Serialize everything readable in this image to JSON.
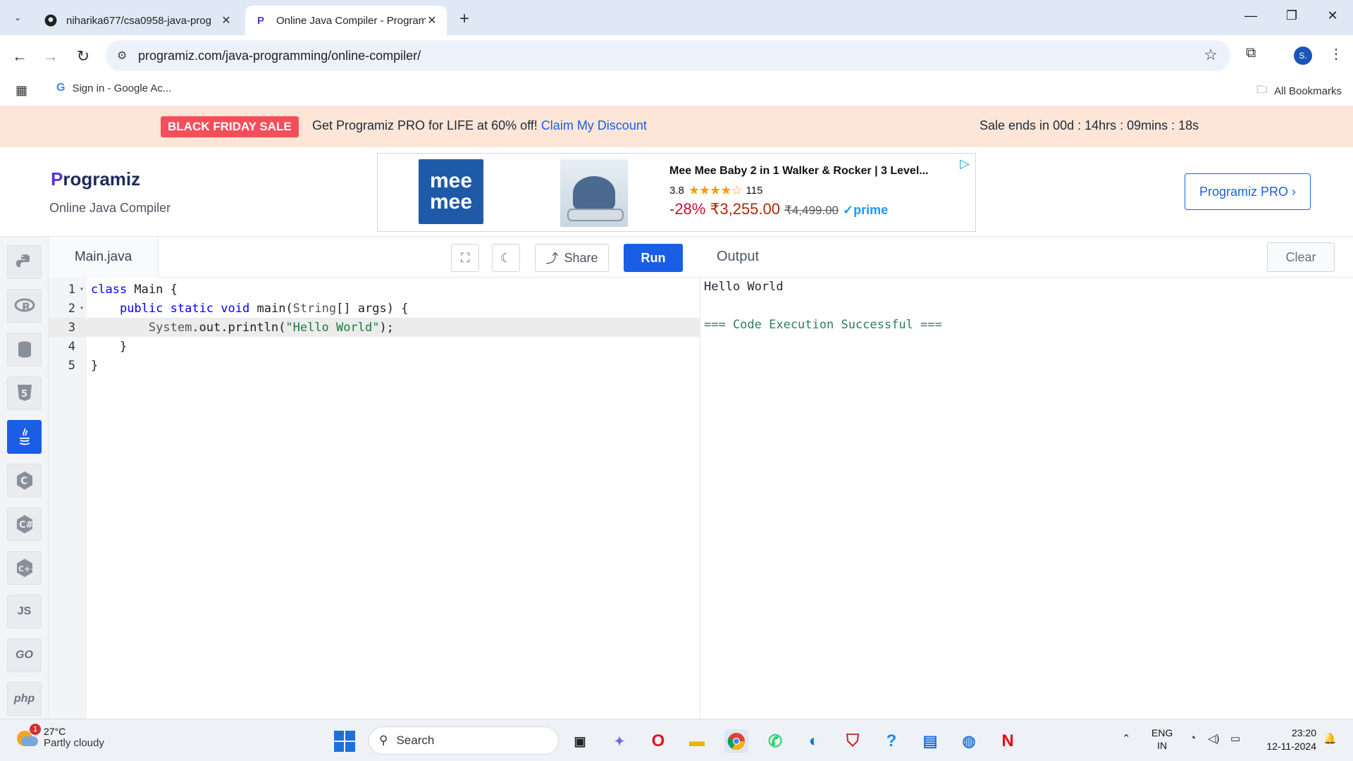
{
  "browser": {
    "tabs": [
      {
        "title": "niharika677/csa0958-java-prog",
        "active": false
      },
      {
        "title": "Online Java Compiler - Program",
        "active": true
      }
    ],
    "url": "programiz.com/java-programming/online-compiler/",
    "profile_initial": "S.",
    "bookmarks": [
      {
        "label": "Sign in - Google Ac..."
      }
    ],
    "all_bookmarks_label": "All Bookmarks"
  },
  "sale": {
    "badge": "BLACK FRIDAY SALE",
    "text": "Get Programiz PRO for LIFE at 60% off!",
    "link": "Claim My Discount",
    "timer": "Sale ends in 00d : 14hrs : 09mins : 18s"
  },
  "header": {
    "logo": "rogramiz",
    "logo_p": "P",
    "subtitle": "Online Java Compiler",
    "pro_button": "Programiz PRO ›"
  },
  "ad": {
    "brand_line1": "mee",
    "brand_line2": "mee",
    "title": "Mee Mee Baby 2 in 1 Walker & Rocker | 3 Level...",
    "rating": "3.8",
    "stars": "★★★★☆",
    "reviews": "115",
    "discount": "-28%",
    "price": "₹3,255.00",
    "old_price": "₹4,499.00",
    "prime": "✓prime"
  },
  "languages": [
    "python",
    "r",
    "sql",
    "html",
    "java",
    "c",
    "csharp",
    "cpp",
    "JS",
    "GO",
    "php"
  ],
  "editor": {
    "file_name": "Main.java",
    "share_label": "Share",
    "run_label": "Run",
    "lines": [
      {
        "n": "1",
        "fold": "▾"
      },
      {
        "n": "2",
        "fold": "▾"
      },
      {
        "n": "3",
        "fold": ""
      },
      {
        "n": "4",
        "fold": ""
      },
      {
        "n": "5",
        "fold": ""
      }
    ],
    "code": {
      "l1_kw": "class",
      "l1_rest": " Main {",
      "l2_kw1": "public",
      "l2_kw2": "static",
      "l2_kw3": "void",
      "l2_a": " main(",
      "l2_type": "String",
      "l2_b": "[] args) {",
      "l3_cls": "System",
      "l3_a": ".out.println(",
      "l3_str": "\"Hello World\"",
      "l3_b": ");",
      "l4": "    }",
      "l5": "}"
    }
  },
  "output": {
    "title": "Output",
    "clear_label": "Clear",
    "lines": [
      "Hello World",
      "=== Code Execution Successful ==="
    ]
  },
  "taskbar": {
    "weather_temp": "27°C",
    "weather_desc": "Partly cloudy",
    "weather_badge": "1",
    "search_placeholder": "Search",
    "lang_top": "ENG",
    "lang_bottom": "IN",
    "time": "23:20",
    "date": "12-11-2024"
  }
}
